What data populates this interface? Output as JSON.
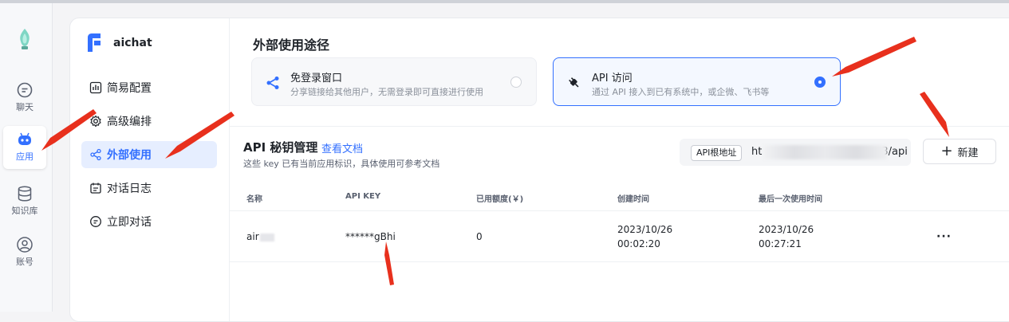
{
  "app_nav": {
    "items": [
      {
        "label": "聊天",
        "icon": "chat-icon"
      },
      {
        "label": "应用",
        "icon": "robot-icon",
        "active": true
      },
      {
        "label": "知识库",
        "icon": "database-icon"
      },
      {
        "label": "账号",
        "icon": "user-icon"
      }
    ]
  },
  "sidebar": {
    "app_name": "aichat",
    "items": [
      {
        "label": "简易配置",
        "icon": "chart-icon"
      },
      {
        "label": "高级编排",
        "icon": "gear-icon"
      },
      {
        "label": "外部使用",
        "icon": "share-icon",
        "active": true
      },
      {
        "label": "对话日志",
        "icon": "calendar-icon"
      },
      {
        "label": "立即对话",
        "icon": "chat-icon"
      }
    ]
  },
  "usage": {
    "title": "外部使用途径",
    "options": [
      {
        "title": "免登录窗口",
        "desc": "分享链接给其他用户，无需登录即可直接进行使用",
        "selected": false,
        "icon": "share-icon"
      },
      {
        "title": "API 访问",
        "desc": "通过 API 接入到已有系统中，或企微、飞书等",
        "selected": true,
        "icon": "plug-icon"
      }
    ]
  },
  "api": {
    "title": "API 秘钥管理",
    "doc_link": "查看文档",
    "subtitle": "这些 key 已有当前应用标识，具体使用可参考文档",
    "base_url_label": "API根地址",
    "base_url_prefix": "ht",
    "base_url_suffix": "3/api",
    "new_button": "新建",
    "columns": [
      "名称",
      "API KEY",
      "已用额度(￥)",
      "创建时间",
      "最后一次使用时间"
    ],
    "rows": [
      {
        "name": "air",
        "key": "******gBhi",
        "used": "0",
        "created_date": "2023/10/26",
        "created_time": "00:02:20",
        "last_used_date": "2023/10/26",
        "last_used_time": "00:27:21",
        "more": "···"
      }
    ]
  },
  "colors": {
    "accent": "#3370ff",
    "annotation_arrow": "#e8301d"
  }
}
